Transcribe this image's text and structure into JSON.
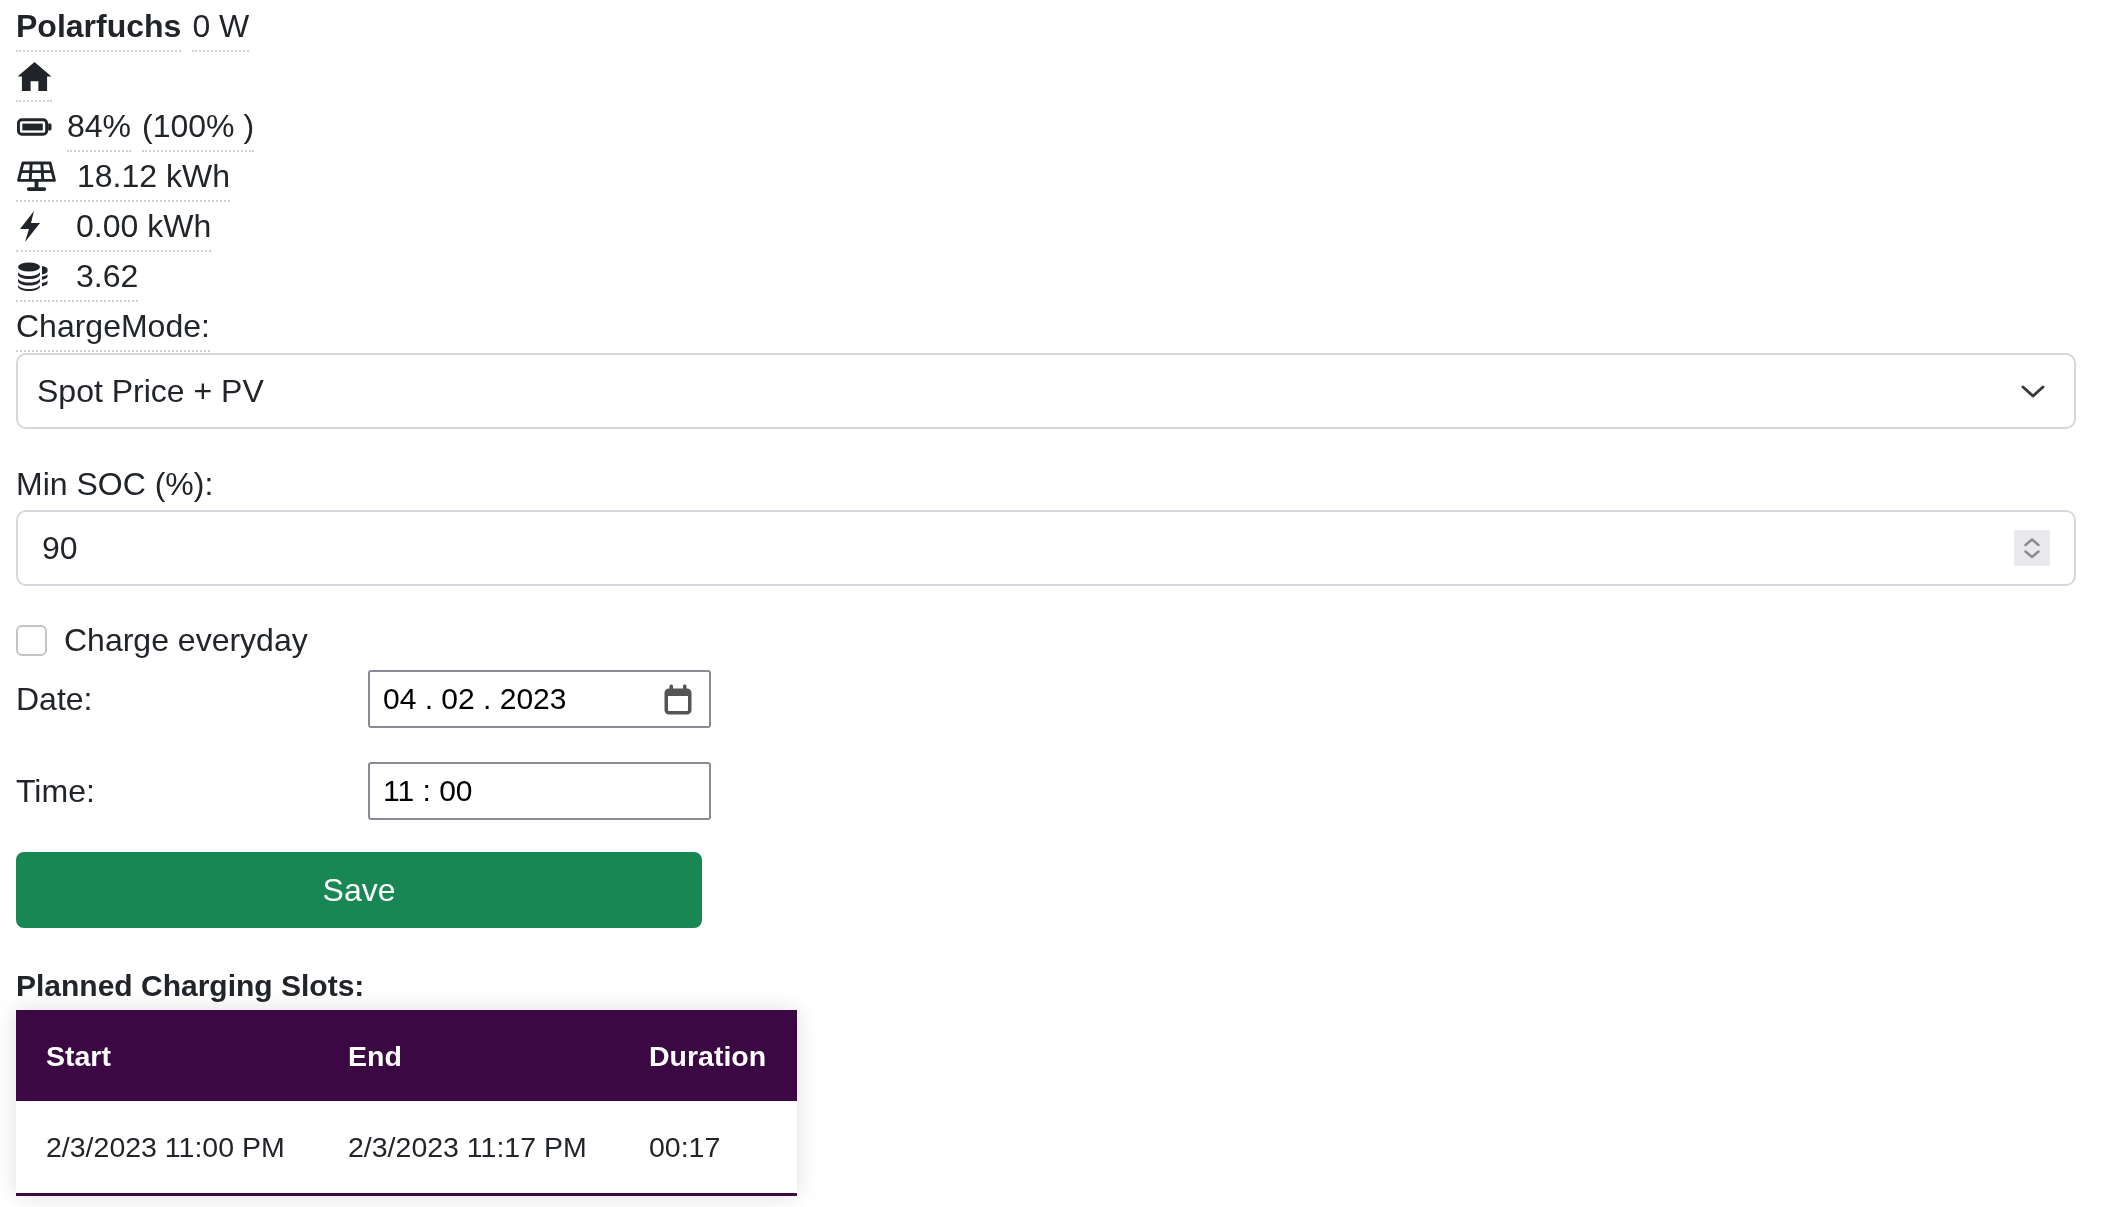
{
  "device": {
    "name": "Polarfuchs",
    "power": "0 W"
  },
  "stats": [
    {
      "kind": "home"
    },
    {
      "kind": "battery",
      "values": [
        "84%",
        "(100% )"
      ]
    },
    {
      "kind": "solar",
      "values": [
        "18.12 kWh"
      ]
    },
    {
      "kind": "bolt",
      "values": [
        "0.00 kWh"
      ]
    },
    {
      "kind": "coins",
      "values": [
        "3.62"
      ]
    }
  ],
  "charge_mode": {
    "label": "ChargeMode:",
    "value": "Spot Price + PV"
  },
  "min_soc": {
    "label": "Min SOC (%):",
    "value": "90"
  },
  "charge_everyday": {
    "label": "Charge everyday",
    "checked": false
  },
  "date": {
    "label": "Date:",
    "value": "04 . 02 . 2023"
  },
  "time": {
    "label": "Time:",
    "value": "11 : 00"
  },
  "save_button": {
    "label": "Save"
  },
  "planned_slots": {
    "title": "Planned Charging Slots:",
    "columns": [
      "Start",
      "End",
      "Duration"
    ],
    "rows": [
      [
        "2/3/2023 11:00 PM",
        "2/3/2023 11:17 PM",
        "00:17"
      ]
    ]
  }
}
